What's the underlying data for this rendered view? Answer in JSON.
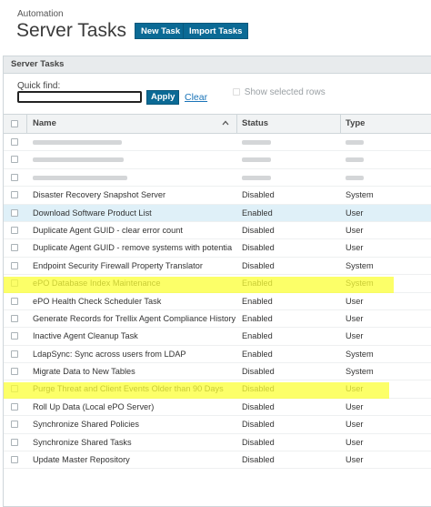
{
  "header": {
    "breadcrumb": "Automation",
    "title": "Server Tasks",
    "new_task_label": "New Task",
    "import_tasks_label": "Import Tasks"
  },
  "panel": {
    "title": "Server Tasks",
    "quick_find_label": "Quick find:",
    "quick_find_value": "",
    "apply_label": "Apply",
    "clear_label": "Clear",
    "show_selected_label": "Show selected rows"
  },
  "table": {
    "columns": {
      "name": "Name",
      "status": "Status",
      "type": "Type"
    },
    "rows": [
      {
        "name": "Disaster Recovery Snapshot Server",
        "status": "Disabled",
        "type": "System"
      },
      {
        "name": "Download Software Product List",
        "status": "Enabled",
        "type": "User"
      },
      {
        "name": "Duplicate Agent GUID - clear error count",
        "status": "Disabled",
        "type": "User"
      },
      {
        "name": "Duplicate Agent GUID - remove systems with potentia",
        "status": "Disabled",
        "type": "User"
      },
      {
        "name": "Endpoint Security Firewall Property Translator",
        "status": "Disabled",
        "type": "System"
      },
      {
        "name": "ePO Database Index Maintenance",
        "status": "Enabled",
        "type": "System"
      },
      {
        "name": "ePO Health Check Scheduler Task",
        "status": "Enabled",
        "type": "User"
      },
      {
        "name": "Generate Records for Trellix Agent Compliance History",
        "status": "Enabled",
        "type": "User"
      },
      {
        "name": "Inactive Agent Cleanup Task",
        "status": "Enabled",
        "type": "User"
      },
      {
        "name": "LdapSync: Sync across users from LDAP",
        "status": "Enabled",
        "type": "System"
      },
      {
        "name": "Migrate Data to New Tables",
        "status": "Disabled",
        "type": "System"
      },
      {
        "name": "Purge Threat and Client Events Older than 90 Days",
        "status": "Disabled",
        "type": "User"
      },
      {
        "name": "Roll Up Data (Local ePO Server)",
        "status": "Disabled",
        "type": "User"
      },
      {
        "name": "Synchronize Shared Policies",
        "status": "Disabled",
        "type": "User"
      },
      {
        "name": "Synchronize Shared Tasks",
        "status": "Disabled",
        "type": "User"
      },
      {
        "name": "Update Master Repository",
        "status": "Disabled",
        "type": "User"
      }
    ]
  },
  "colors": {
    "button_bg": "#0b6a95",
    "link": "#1a74b8",
    "selected_row": "#dff0f8",
    "highlight": "#fbff36"
  }
}
